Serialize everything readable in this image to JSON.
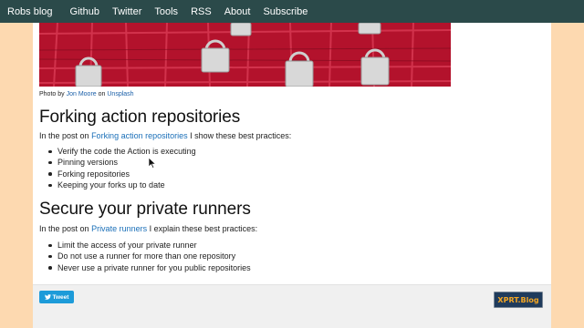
{
  "nav": {
    "brand": "Robs blog",
    "links": [
      "Github",
      "Twitter",
      "Tools",
      "RSS",
      "About",
      "Subscribe"
    ]
  },
  "hero": {
    "credit_prefix": "Photo by",
    "credit_author": "Jon Moore",
    "credit_middle": "on",
    "credit_site": "Unsplash"
  },
  "sections": [
    {
      "title": "Forking action repositories",
      "intro_prefix": "In the post on",
      "intro_link": "Forking action repositories",
      "intro_suffix": "I show these best practices:",
      "items": [
        "Verify the code the Action is executing",
        "Pinning versions",
        "Forking repositories",
        "Keeping your forks up to date"
      ]
    },
    {
      "title": "Secure your private runners",
      "intro_prefix": "In the post on",
      "intro_link": "Private runners",
      "intro_suffix": "I explain these best practices:",
      "items": [
        "Limit the access of your private runner",
        "Do not use a runner for more than one repository",
        "Never use a private runner for you public repositories"
      ]
    }
  ],
  "footer": {
    "tweet_label": "Tweet",
    "badge_text": "XPRT.Blog"
  },
  "colors": {
    "navbar": "#2b4a4a",
    "page_background": "#fdd9b0",
    "link": "#1a6fb8",
    "hero_red": "#b0102a",
    "tweet_blue": "#1d9bd9"
  }
}
